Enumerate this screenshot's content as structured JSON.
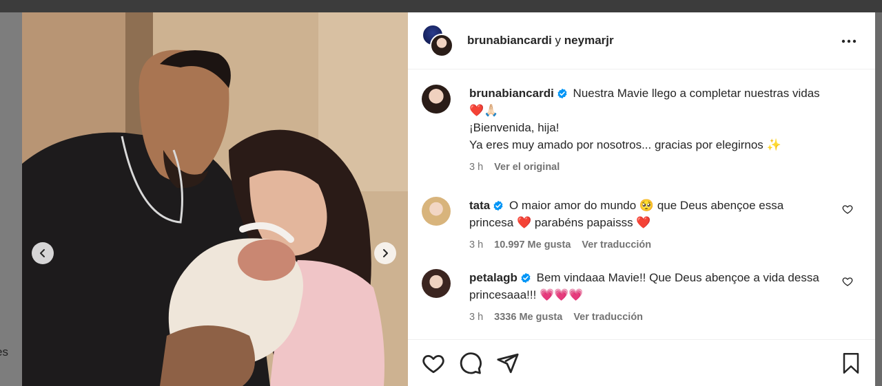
{
  "background": {
    "left_fragment": "es"
  },
  "post": {
    "header": {
      "user1": "brunabiancardi",
      "joiner": "y",
      "user2": "neymarjr",
      "more_icon": "more-horizontal-icon"
    },
    "caption": {
      "username": "brunabiancardi",
      "verified": true,
      "line1": "Nuestra Mavie llego a completar nuestras vidas ❤️🙏🏻",
      "line2": "¡Bienvenida, hija!",
      "line3": "Ya eres muy amado por nosotros... gracias por elegirnos ✨",
      "time": "3 h",
      "see_original": "Ver el original"
    },
    "comments": [
      {
        "username": "tata",
        "verified": true,
        "text": "O maior amor do mundo 🥺 que Deus abençoe essa princesa ❤️ parabéns papaisss ❤️",
        "time": "3 h",
        "likes": "10.997 Me gusta",
        "translate": "Ver traducción"
      },
      {
        "username": "petalagb",
        "verified": true,
        "text": "Bem vindaaa Mavie!! Que Deus abençoe a vida dessa princesaaa!!! 💗💗💗",
        "time": "3 h",
        "likes": "3336 Me gusta",
        "translate": "Ver traducción"
      }
    ],
    "actions": [
      "heart-icon",
      "comment-icon",
      "share-icon",
      "bookmark-icon"
    ],
    "colors": {
      "verified": "#0095f6",
      "text": "#262626",
      "meta": "#737373",
      "divider": "#efefef"
    }
  }
}
